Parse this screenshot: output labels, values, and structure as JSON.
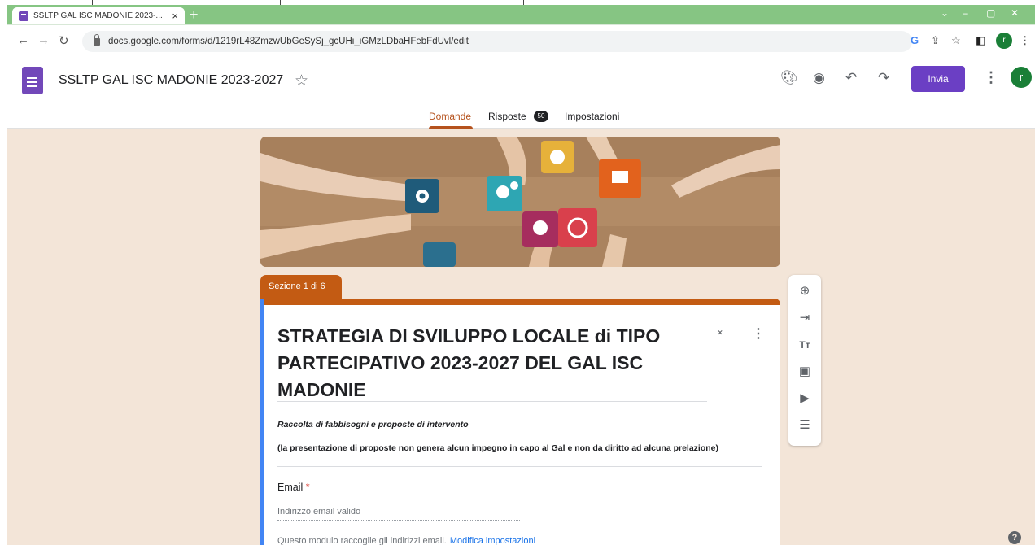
{
  "browser": {
    "tab_title": "SSLTP GAL ISC MADONIE 2023-...",
    "url": "docs.google.com/forms/d/1219rL48ZmzwUbGeSySj_gcUHi_iGMzLDbaHFebFdUvl/edit",
    "profile_initial": "r"
  },
  "app": {
    "doc_title": "SSLTP GAL ISC MADONIE 2023-2027",
    "send_label": "Invia",
    "avatar_initial": "r"
  },
  "tabs": [
    {
      "label": "Domande"
    },
    {
      "label": "Risposte"
    },
    {
      "label": "Impostazioni"
    }
  ],
  "responses_count": "50",
  "section": {
    "label": "Sezione 1 di 6"
  },
  "form": {
    "title": "STRATEGIA DI SVILUPPO LOCALE di TIPO PARTECIPATIVO 2023-2027 DEL GAL ISC MADONIE",
    "desc_line1": "Raccolta di fabbisogni e proposte di intervento",
    "desc_line2": "(la presentazione di proposte non genera alcun impegno in capo al Gal e non da diritto ad alcuna prelazione)",
    "email_label": "Email",
    "email_required": "*",
    "email_placeholder": "Indirizzo email valido",
    "email_note": "Questo modulo raccoglie gli indirizzi email.",
    "email_note_link": "Modifica impostazioni"
  },
  "colors": {
    "chrome_frame": "#86c583",
    "theme": "#c35b13",
    "canvas": "#f3e5d8",
    "send_button": "#6b3fc4",
    "accent": "#4285f4"
  }
}
